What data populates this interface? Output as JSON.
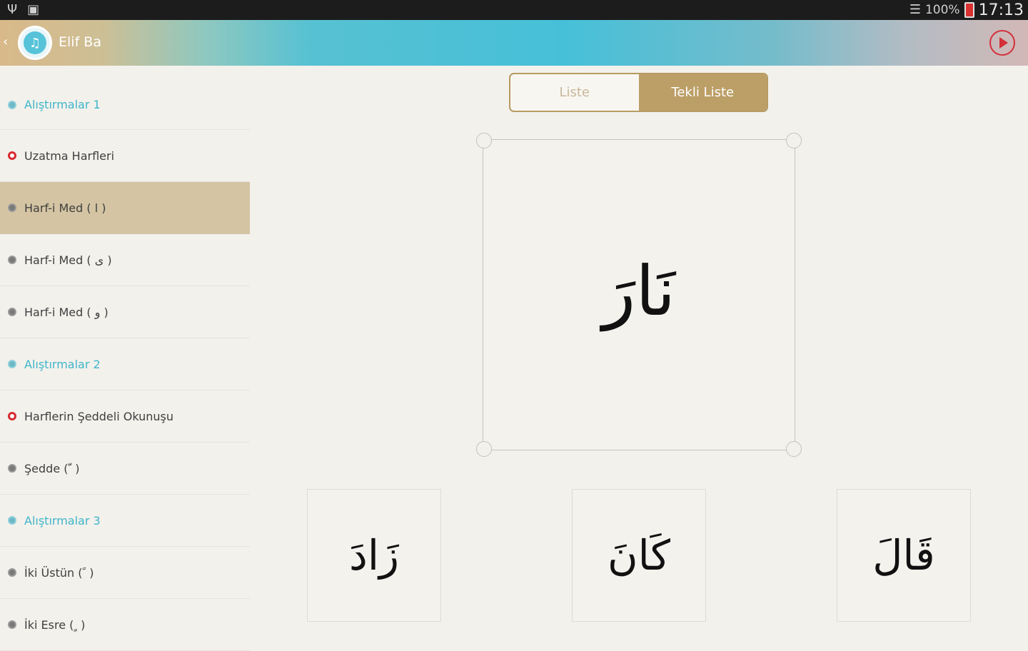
{
  "status_bar": {
    "left_icons": [
      "usb-icon",
      "sd-card-icon"
    ],
    "signal_icon": "wifi-icon",
    "battery_percent": "100%",
    "time": "17:13"
  },
  "app_bar": {
    "title": "Elif Ba",
    "logo_glyph": "♫"
  },
  "sidebar": {
    "items": [
      {
        "label": "Alıştırmalar 1",
        "type": "exercise"
      },
      {
        "label": "Uzatma Harfleri",
        "type": "section"
      },
      {
        "label": "Harf-i Med ( ا )",
        "type": "item",
        "active": true
      },
      {
        "label": "Harf-i Med ( ى )",
        "type": "item"
      },
      {
        "label": "Harf-i Med ( و )",
        "type": "item"
      },
      {
        "label": "Alıştırmalar 2",
        "type": "exercise"
      },
      {
        "label": "Harflerin Şeddeli Okunuşu",
        "type": "section"
      },
      {
        "label": "Şedde ( ّ )",
        "type": "item"
      },
      {
        "label": "Alıştırmalar 3",
        "type": "exercise"
      },
      {
        "label": "İki Üstün ( ً )",
        "type": "item"
      },
      {
        "label": "İki Esre ( ٍ )",
        "type": "item"
      }
    ]
  },
  "tabs": [
    {
      "label": "Liste",
      "selected": false
    },
    {
      "label": "Tekli Liste",
      "selected": true
    }
  ],
  "main_card": {
    "word": "نَارَ"
  },
  "options": [
    {
      "word": "زَادَ"
    },
    {
      "word": "كَانَ"
    },
    {
      "word": "قَالَ"
    }
  ]
}
